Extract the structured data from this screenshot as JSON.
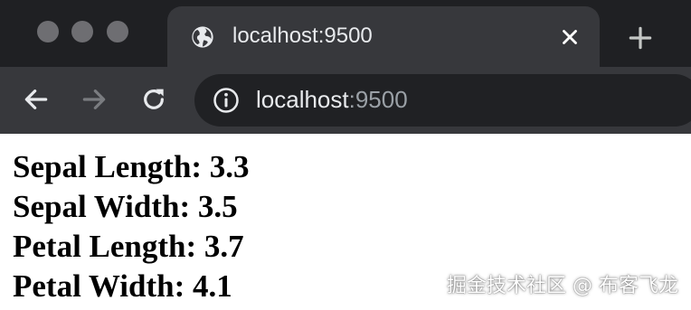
{
  "window": {
    "traffic_lights": [
      "close",
      "minimize",
      "zoom"
    ],
    "colors": {
      "tabstrip_bg": "#1f2023",
      "active_tab_bg": "#37383c",
      "omnibox_bg": "#202124"
    }
  },
  "tab": {
    "title": "localhost:9500",
    "favicon": "globe-icon",
    "close_icon": "close-icon"
  },
  "new_tab_icon": "plus-icon",
  "toolbar": {
    "back_icon": "back-arrow-icon",
    "forward_icon": "forward-arrow-icon",
    "reload_icon": "reload-icon",
    "site_info_icon": "info-icon",
    "url_host": "localhost",
    "url_port": ":9500"
  },
  "page": {
    "lines": [
      "Sepal Length: 3.3",
      "Sepal Width: 3.5",
      "Petal Length: 3.7",
      "Petal Width: 4.1"
    ]
  },
  "watermark": "掘金技术社区 @ 布客飞龙"
}
